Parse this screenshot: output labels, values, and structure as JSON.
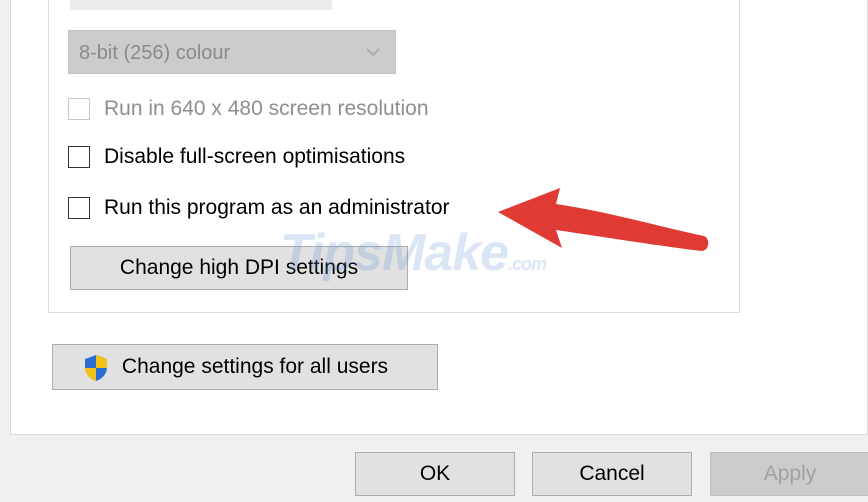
{
  "color_mode": {
    "value": "8-bit (256) colour",
    "enabled": false
  },
  "checkboxes": [
    {
      "label": "Run in 640 x 480 screen resolution",
      "checked": false,
      "enabled": false
    },
    {
      "label": "Disable full-screen optimisations",
      "checked": false,
      "enabled": true
    },
    {
      "label": "Run this program as an administrator",
      "checked": false,
      "enabled": true
    }
  ],
  "buttons": {
    "change_dpi": "Change high DPI settings",
    "change_all_users": "Change settings for all users",
    "ok": "OK",
    "cancel": "Cancel",
    "apply": "Apply"
  },
  "watermark": {
    "text": "TipsMake",
    "suffix": ".com"
  },
  "colors": {
    "arrow": "#e03a35",
    "shield_blue": "#2a6fd0",
    "shield_yellow": "#f3c21a"
  },
  "icons": {
    "dropdown": "chevron-down-icon",
    "all_users": "uac-shield-icon",
    "annotation": "red-arrow-icon"
  }
}
